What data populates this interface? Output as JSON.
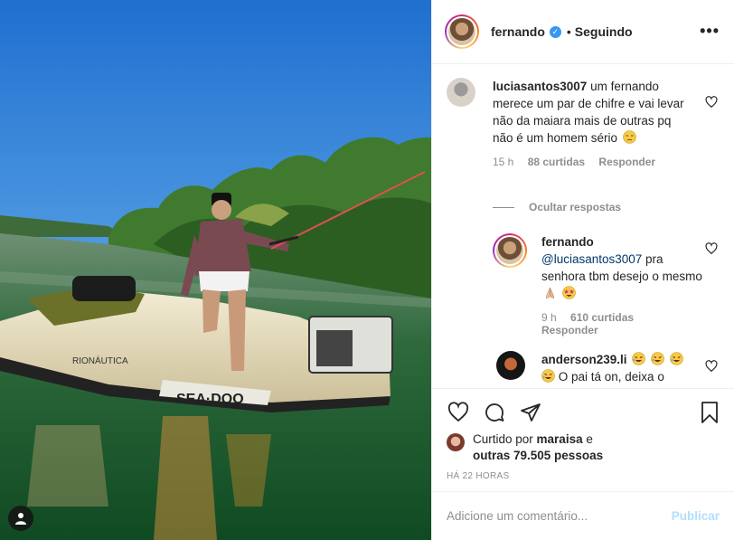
{
  "post": {
    "username": "fernando",
    "separator": "•",
    "follow_status": "Seguindo",
    "more_icon": "more-horizontal-icon"
  },
  "comments": [
    {
      "username": "luciasantos3007",
      "text": " um fernando merece um par de chifre e vai levar não da maiara mais de outras pq não é um homem sério",
      "emoji": "unamused-face",
      "time": "15 h",
      "likes": "88 curtidas",
      "reply_label": "Responder"
    }
  ],
  "hide_replies": "Ocultar respostas",
  "reply": {
    "username": "fernando",
    "mention": "@luciasantos3007",
    "text": " pra senhora tbm desejo o mesmo ",
    "emojis": [
      "folded-hands",
      "star-struck"
    ],
    "time": "9 h",
    "likes": "610 curtidas",
    "reply_label": "Responder"
  },
  "reply2": {
    "username": "anderson239.li",
    "text": " O pai tá on, deixa o",
    "emojis": [
      "rolling-laughing",
      "rolling-laughing",
      "rolling-laughing",
      "rolling-laughing"
    ]
  },
  "likes": {
    "prefix": "Curtido por ",
    "first_user": "maraisa",
    "middle": " e",
    "others": "outras 79.505 pessoas"
  },
  "timestamp": "HÁ 22 HORAS",
  "comment_box": {
    "placeholder": "Adicione um comentário...",
    "publish_label": "Publicar"
  },
  "colors": {
    "link": "#00376b",
    "publish_disabled": "#b2dffc",
    "verified": "#3897f0",
    "muted": "#8e8e8e"
  }
}
